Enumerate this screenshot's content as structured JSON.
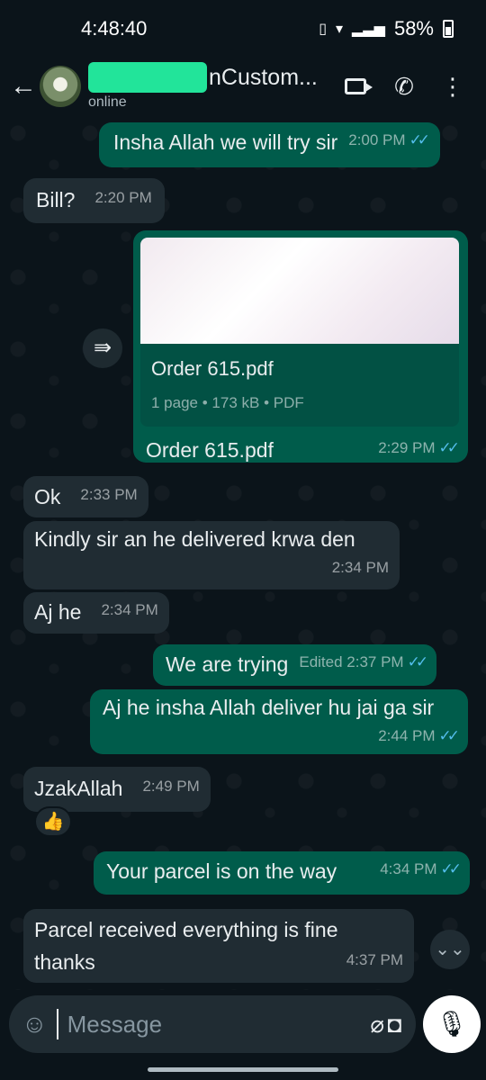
{
  "status_bar": {
    "time": "4:48:40",
    "battery": "58%"
  },
  "header": {
    "contact_name": "Custom...",
    "contact_name_prefix": "n",
    "status": "online"
  },
  "messages": [
    {
      "dir": "out",
      "text": "Insha Allah we will try sir",
      "time": "2:00 PM"
    },
    {
      "dir": "in",
      "text": "Bill?",
      "time": "2:20 PM"
    },
    {
      "dir": "out",
      "type": "document",
      "doc_name": "Order 615.pdf",
      "doc_pages": "1 page",
      "doc_size": "173 kB",
      "doc_type": "PDF",
      "caption": "Order 615.pdf",
      "time": "2:29 PM"
    },
    {
      "dir": "in",
      "text": "Ok",
      "time": "2:33 PM"
    },
    {
      "dir": "in",
      "text": "Kindly  sir  an he delivered krwa den",
      "time": "2:34 PM"
    },
    {
      "dir": "in",
      "text": "Aj he",
      "time": "2:34 PM"
    },
    {
      "dir": "out",
      "text": "We are trying",
      "time": "Edited 2:37 PM"
    },
    {
      "dir": "out",
      "text": "Aj he insha Allah deliver hu jai ga sir",
      "time": "2:44 PM"
    },
    {
      "dir": "in",
      "text": "JzakAllah",
      "time": "2:49 PM",
      "reaction": "👍"
    },
    {
      "dir": "out",
      "text": "Your parcel is on the way",
      "time": "4:34 PM"
    },
    {
      "dir": "in",
      "text_line1": "Parcel received  everything is fine",
      "text_line2": "thanks",
      "time": "4:37 PM"
    }
  ],
  "composer": {
    "placeholder": "Message"
  },
  "icons": {
    "back": "arrow-left-icon",
    "video": "video-call-icon",
    "call": "phone-icon",
    "menu": "more-vert-icon",
    "emoji": "sticker-icon",
    "attach": "paperclip-icon",
    "camera": "camera-icon",
    "mic": "mic-icon"
  },
  "colors": {
    "background": "#0b141a",
    "outgoing": "#005c4b",
    "incoming": "#202c33",
    "read_tick": "#53bdeb",
    "redaction": "#22e49a"
  }
}
